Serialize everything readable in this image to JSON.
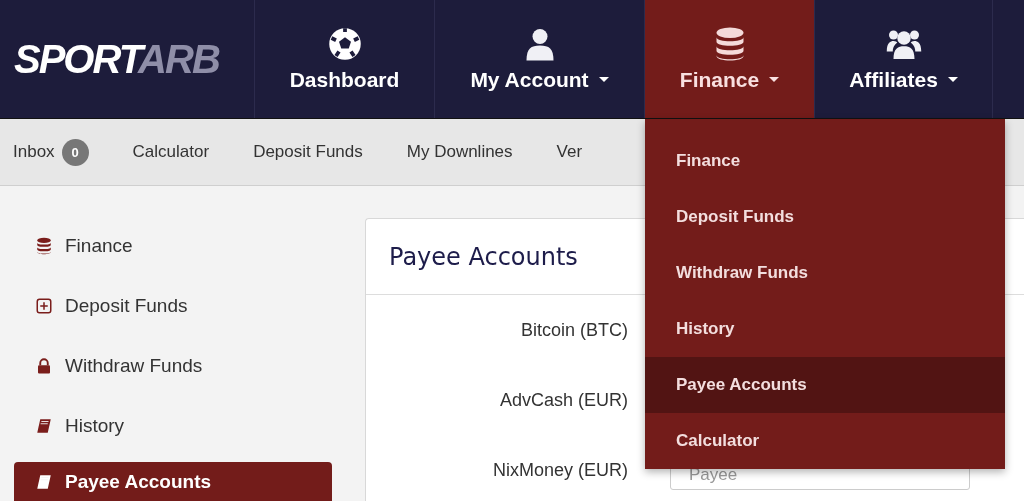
{
  "logo": {
    "primary": "SPORT",
    "secondary": "ARB"
  },
  "nav": [
    {
      "label": "Dashboard",
      "kind": "ball",
      "caret": false,
      "selected": false
    },
    {
      "label": "My Account",
      "kind": "user",
      "caret": true,
      "selected": false
    },
    {
      "label": "Finance",
      "kind": "database",
      "caret": true,
      "selected": true
    },
    {
      "label": "Affiliates",
      "kind": "users",
      "caret": true,
      "selected": false
    }
  ],
  "subnav": [
    {
      "label": "Inbox",
      "badge": "0"
    },
    {
      "label": "Calculator"
    },
    {
      "label": "Deposit Funds"
    },
    {
      "label": "My Downlines"
    },
    {
      "label": "Ver"
    }
  ],
  "dropdown": [
    {
      "label": "Finance",
      "selected": false
    },
    {
      "label": "Deposit Funds",
      "selected": false
    },
    {
      "label": "Withdraw Funds",
      "selected": false
    },
    {
      "label": "History",
      "selected": false
    },
    {
      "label": "Payee Accounts",
      "selected": true
    },
    {
      "label": "Calculator",
      "selected": false
    }
  ],
  "sidebar": [
    {
      "label": "Finance",
      "kind": "database",
      "selected": false
    },
    {
      "label": "Deposit Funds",
      "kind": "plus",
      "selected": false
    },
    {
      "label": "Withdraw Funds",
      "kind": "lock",
      "selected": false
    },
    {
      "label": "History",
      "kind": "book",
      "selected": false
    },
    {
      "label": "Payee Accounts",
      "kind": "book",
      "selected": true
    }
  ],
  "panel": {
    "title": "Payee Accounts",
    "rows": [
      {
        "label": "Bitcoin (BTC)"
      },
      {
        "label": "AdvCash (EUR)"
      },
      {
        "label": "NixMoney (EUR)",
        "placeholder": "Payee"
      }
    ]
  }
}
